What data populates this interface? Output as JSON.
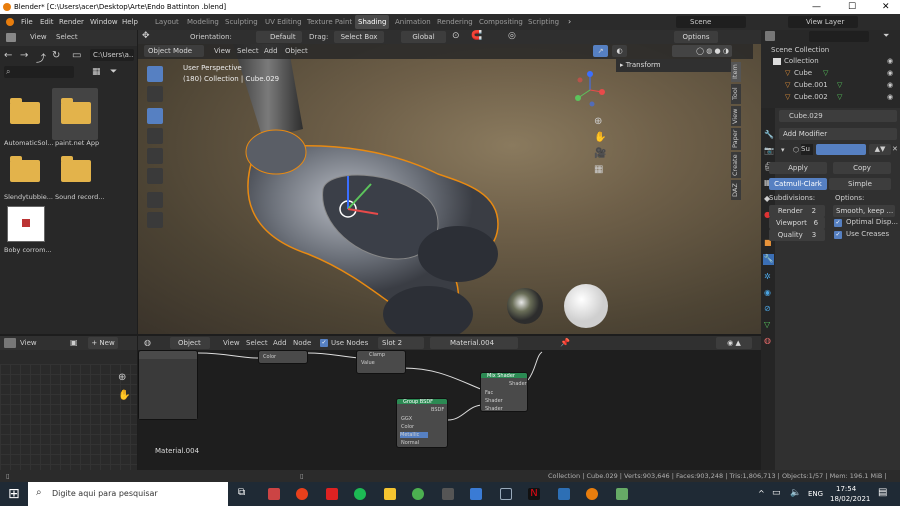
{
  "window": {
    "title": "Blender* [C:\\Users\\acer\\Desktop\\Arte\\Endo Battinton .blend]",
    "minimize": "—",
    "maximize": "☐",
    "close": "✕"
  },
  "menu": [
    "File",
    "Edit",
    "Render",
    "Window",
    "Help"
  ],
  "workspaces": [
    "Layout",
    "Modeling",
    "Sculpting",
    "UV Editing",
    "Texture Paint",
    "Shading",
    "Animation",
    "Rendering",
    "Compositing",
    "Scripting"
  ],
  "scene": {
    "scene": "Scene",
    "view_layer": "View Layer"
  },
  "file_browser": {
    "view": "View",
    "select": "Select",
    "path": "C:\\Users\\a...",
    "items": [
      {
        "name": "AutomaticSol..."
      },
      {
        "name": "paint.net App"
      },
      {
        "name": "Slendytubbie..."
      },
      {
        "name": "Sound record..."
      },
      {
        "name": "Boby corrom..."
      }
    ]
  },
  "viewport": {
    "header": {
      "orientation_label": "Orientation:",
      "orientation": "Default",
      "drag_label": "Drag:",
      "drag": "Select Box",
      "transform": "Global",
      "options": "Options"
    },
    "mode": "Object Mode",
    "view": "View",
    "select": "Select",
    "add": "Add",
    "object": "Object",
    "overlay_line1": "User Perspective",
    "overlay_line2": "(180) Collection | Cube.029",
    "n_panel": "Transform",
    "tabs": [
      "Item",
      "Tool",
      "View",
      "Paper",
      "Create",
      "DAZ"
    ]
  },
  "outliner": {
    "root": "Scene Collection",
    "collection": "Collection",
    "items": [
      "Cube",
      "Cube.001",
      "Cube.002"
    ]
  },
  "properties": {
    "object": "Cube.029",
    "add_modifier": "Add Modifier",
    "mod_name": "Su",
    "apply": "Apply",
    "copy": "Copy",
    "catmull": "Catmull-Clark",
    "simple": "Simple",
    "subdivisions": "Subdivisions:",
    "options": "Options:",
    "render": "Render",
    "render_val": "2",
    "viewport": "Viewport",
    "viewport_val": "6",
    "quality": "Quality",
    "quality_val": "3",
    "smooth": "Smooth, keep ...",
    "optimal": "Optimal Disp...",
    "creases": "Use Creases"
  },
  "node_editor": {
    "type": "Object",
    "view": "View",
    "select": "Select",
    "add": "Add",
    "node": "Node",
    "use_nodes": "Use Nodes",
    "slot": "Slot 2",
    "material": "Material.004",
    "footer": "Material.004",
    "nodes": {
      "mix": "Mix Shader",
      "group": "Group BSDF",
      "clamp": "Clamp",
      "color": "Color",
      "value": "Value",
      "fac": "Fac",
      "shader": "Shader",
      "bsdf": "BSDF",
      "ggx": "GGX",
      "metallic": "Metallic",
      "normal": "Normal"
    }
  },
  "left_node": {
    "view": "View",
    "new": "New"
  },
  "status": "Collection | Cube.029 | Verts:903,646 | Faces:903,248 | Tris:1,806,713 | Objects:1/57 | Mem: 196.1 MiB | 2.83.12",
  "taskbar": {
    "search": "Digite aqui para pesquisar",
    "lang": "ENG",
    "time": "17:54",
    "date": "18/02/2021"
  }
}
